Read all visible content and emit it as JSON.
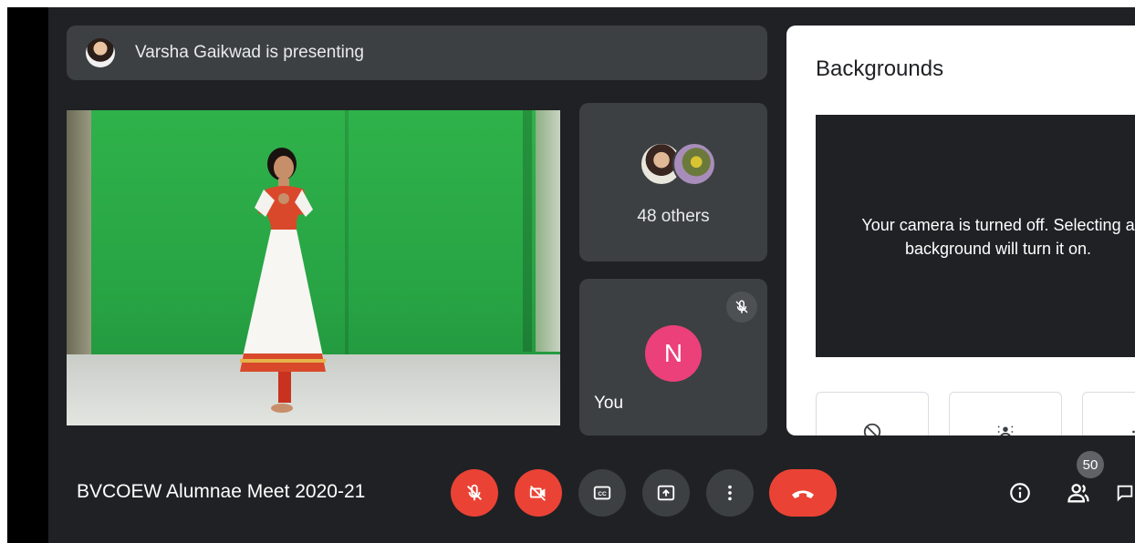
{
  "presenter_banner": {
    "text": "Varsha Gaikwad is presenting"
  },
  "participants": {
    "others_label": "48 others",
    "self": {
      "label": "You",
      "initial": "N",
      "avatar_color": "#ec407a"
    }
  },
  "backgrounds_panel": {
    "title": "Backgrounds",
    "message_line1": "Your camera is turned off. Selecting a",
    "message_line2": "background will turn it on.",
    "options": [
      "no-effect-icon",
      "blur-icon",
      "blur-strong-icon"
    ]
  },
  "meeting": {
    "title": "BVCOEW Alumnae Meet 2020-21"
  },
  "controls": {
    "mic": "mic-off-icon",
    "camera": "camera-off-icon",
    "captions": "captions-icon",
    "present": "present-screen-icon",
    "more": "more-options-icon",
    "leave": "end-call-icon"
  },
  "right_controls": {
    "info": "info-icon",
    "people": "people-icon",
    "people_count": "50",
    "chat": "chat-icon"
  },
  "colors": {
    "accent_red": "#ea4335",
    "background": "#202124",
    "tile": "#3c4043"
  }
}
